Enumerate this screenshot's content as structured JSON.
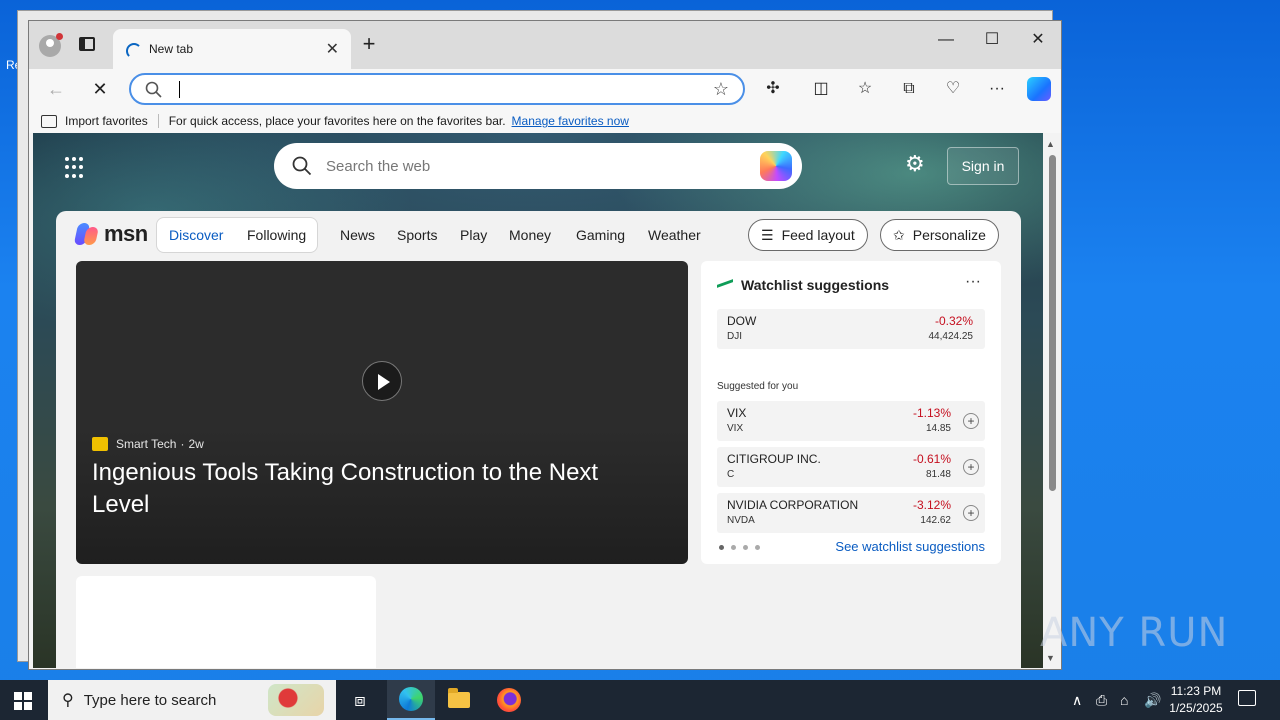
{
  "browser": {
    "tab_title": "New tab",
    "address_value": "",
    "favorites_bar": {
      "import_label": "Import favorites",
      "hint": "For quick access, place your favorites here on the favorites bar.",
      "manage_link": "Manage favorites now"
    }
  },
  "msn": {
    "search_placeholder": "Search the web",
    "signin_label": "Sign in",
    "logo_text": "msn",
    "nav": [
      "Discover",
      "Following",
      "News",
      "Sports",
      "Play",
      "Money",
      "Gaming",
      "Weather"
    ],
    "feed_layout_label": "Feed layout",
    "personalize_label": "Personalize",
    "hero": {
      "source": "Smart Tech",
      "age": "2w",
      "title": "Ingenious Tools Taking Construction to the Next Level"
    },
    "watchlist": {
      "title": "Watchlist suggestions",
      "main": {
        "name": "DOW",
        "symbol": "DJI",
        "change": "-0.32%",
        "price": "44,424.25"
      },
      "suggested_label": "Suggested for you",
      "suggested": [
        {
          "name": "VIX",
          "symbol": "VIX",
          "change": "-1.13%",
          "price": "14.85"
        },
        {
          "name": "CITIGROUP INC.",
          "symbol": "C",
          "change": "-0.61%",
          "price": "81.48"
        },
        {
          "name": "NVIDIA CORPORATION",
          "symbol": "NVDA",
          "change": "-3.12%",
          "price": "142.62"
        }
      ],
      "see_more": "See watchlist suggestions",
      "negative_color": "#c50f1f"
    }
  },
  "taskbar": {
    "search_placeholder": "Type here to search",
    "time": "11:23 PM",
    "date": "1/25/2025"
  },
  "watermark": "ANY RUN",
  "desktop_label": "Re"
}
